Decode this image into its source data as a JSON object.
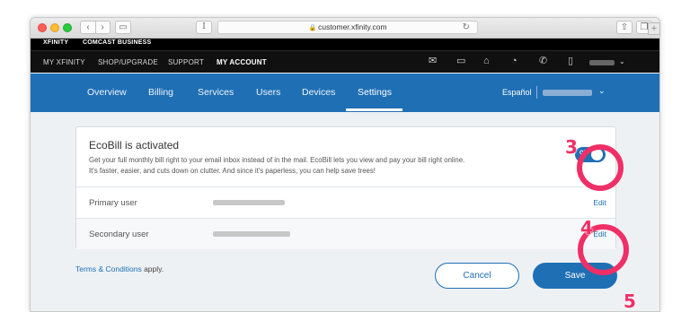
{
  "browser": {
    "url": "customer.xfinity.com",
    "nav_back_icon": "chevron-left-icon",
    "nav_forward_icon": "chevron-right-icon"
  },
  "top_bar": {
    "brand": "XFINITY",
    "business": "COMCAST BUSINESS"
  },
  "main_nav": {
    "items": [
      "MY XFINITY",
      "SHOP/UPGRADE",
      "SUPPORT",
      "MY ACCOUNT"
    ],
    "active": "MY ACCOUNT",
    "icons": [
      "mail-icon",
      "tv-icon",
      "home-icon",
      "wifi-icon",
      "phone-icon",
      "mobile-icon"
    ]
  },
  "sub_nav": {
    "tabs": [
      "Overview",
      "Billing",
      "Services",
      "Users",
      "Devices",
      "Settings"
    ],
    "active": "Settings",
    "language": "Español"
  },
  "ecobill": {
    "title": "EcoBill is activated",
    "description_line1": "Get your full monthly bill right to your email inbox instead of in the mail. EcoBill lets you view and pay your bill right online.",
    "description_line2": "It's faster, easier, and cuts down on clutter. And since it's paperless, you can help save trees!",
    "toggle_label": "ON",
    "toggle_state": true,
    "primary_user_label": "Primary user",
    "secondary_user_label": "Secondary user",
    "edit_label": "Edit"
  },
  "footer": {
    "terms_link": "Terms & Conditions",
    "terms_suffix": "apply.",
    "cancel_label": "Cancel",
    "save_label": "Save"
  },
  "annotations": {
    "step3": "3",
    "step4": "4",
    "step5": "5",
    "color": "#ef2f66"
  },
  "colors": {
    "brand_blue": "#1f6fb5",
    "top_bar": "#000000"
  }
}
